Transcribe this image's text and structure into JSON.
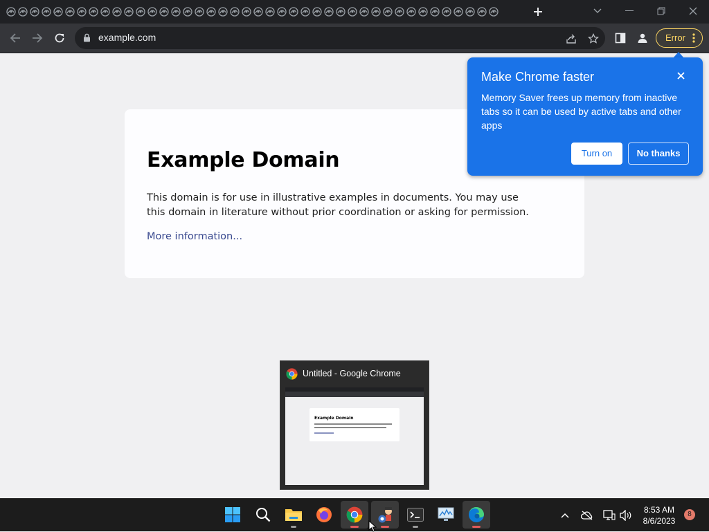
{
  "browser": {
    "tab_count": 42,
    "new_tab_icon": "plus-icon",
    "url": "example.com",
    "error_chip_label": "Error",
    "colors": {
      "tabstrip": "#202124",
      "toolbar": "#35363a",
      "omnibox": "#202124",
      "error_accent": "#fdd663"
    }
  },
  "page": {
    "heading": "Example Domain",
    "body": "This domain is for use in illustrative examples in documents. You may use this domain in literature without prior coordination or asking for permission.",
    "link": "More information..."
  },
  "bubble": {
    "title": "Make Chrome faster",
    "body": "Memory Saver frees up memory from inactive tabs so it can be used by active tabs and other apps",
    "turn_on_label": "Turn on",
    "no_thanks_label": "No thanks",
    "color": "#1a73e8"
  },
  "preview": {
    "window_title": "Untitled - Google Chrome",
    "thumb_heading": "Example Domain"
  },
  "taskbar": {
    "apps": [
      "start-icon",
      "search-icon",
      "file-explorer-icon",
      "firefox-icon",
      "chrome-icon",
      "app-icon",
      "terminal-icon",
      "monitor-icon",
      "edge-icon"
    ],
    "time": "8:53 AM",
    "date": "8/6/2023",
    "notification_count": "8"
  }
}
